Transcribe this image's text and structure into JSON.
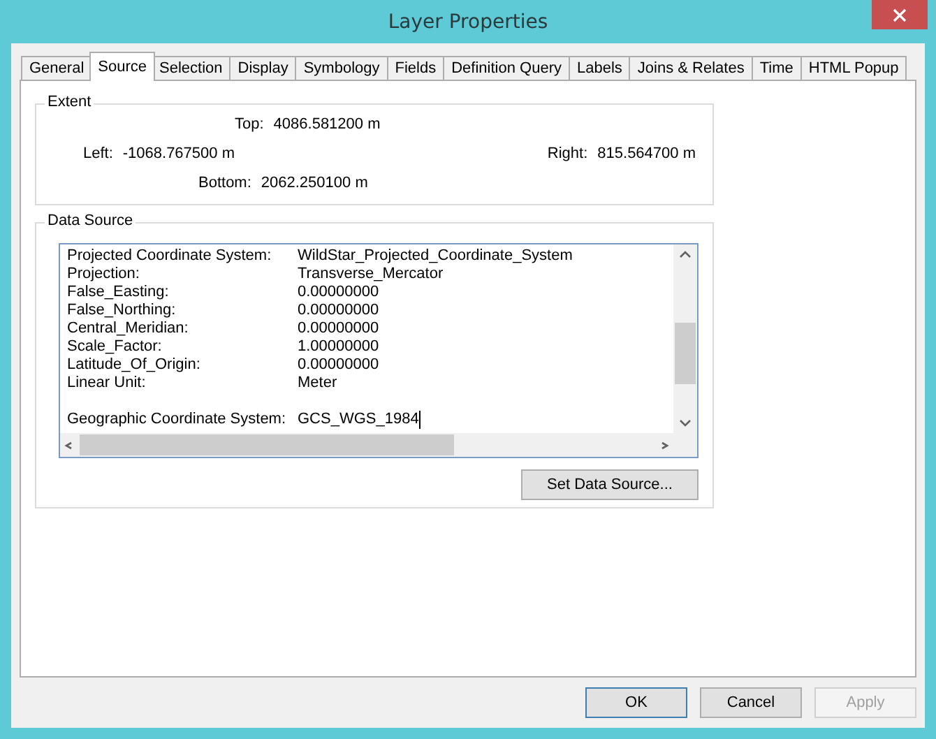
{
  "window": {
    "title": "Layer Properties"
  },
  "tabs": [
    {
      "label": "General",
      "selected": false
    },
    {
      "label": "Source",
      "selected": true
    },
    {
      "label": "Selection",
      "selected": false
    },
    {
      "label": "Display",
      "selected": false
    },
    {
      "label": "Symbology",
      "selected": false
    },
    {
      "label": "Fields",
      "selected": false
    },
    {
      "label": "Definition Query",
      "selected": false
    },
    {
      "label": "Labels",
      "selected": false
    },
    {
      "label": "Joins & Relates",
      "selected": false
    },
    {
      "label": "Time",
      "selected": false
    },
    {
      "label": "HTML Popup",
      "selected": false
    }
  ],
  "extent": {
    "title": "Extent",
    "top_label": "Top:",
    "top": "4086.581200 m",
    "left_label": "Left:",
    "left": "-1068.767500 m",
    "right_label": "Right:",
    "right": "815.564700 m",
    "bottom_label": "Bottom:",
    "bottom": "2062.250100 m"
  },
  "data_source": {
    "title": "Data Source",
    "sections": [
      {
        "rows": [
          {
            "name": "Projected Coordinate System:",
            "value": "WildStar_Projected_Coordinate_System"
          },
          {
            "name": "Projection:",
            "value": "Transverse_Mercator"
          },
          {
            "name": "False_Easting:",
            "value": "0.00000000"
          },
          {
            "name": "False_Northing:",
            "value": "0.00000000"
          },
          {
            "name": "Central_Meridian:",
            "value": "0.00000000"
          },
          {
            "name": "Scale_Factor:",
            "value": "1.00000000"
          },
          {
            "name": "Latitude_Of_Origin:",
            "value": "0.00000000"
          },
          {
            "name": "Linear Unit:",
            "value": "Meter"
          }
        ]
      },
      {
        "rows": [
          {
            "name": "Geographic Coordinate System:",
            "value": "GCS_WGS_1984"
          }
        ]
      }
    ],
    "button": "Set Data Source..."
  },
  "buttons": [
    {
      "label": "OK",
      "disabled": false,
      "default": true
    },
    {
      "label": "Cancel",
      "disabled": false,
      "default": false
    },
    {
      "label": "Apply",
      "disabled": true,
      "default": false
    }
  ]
}
